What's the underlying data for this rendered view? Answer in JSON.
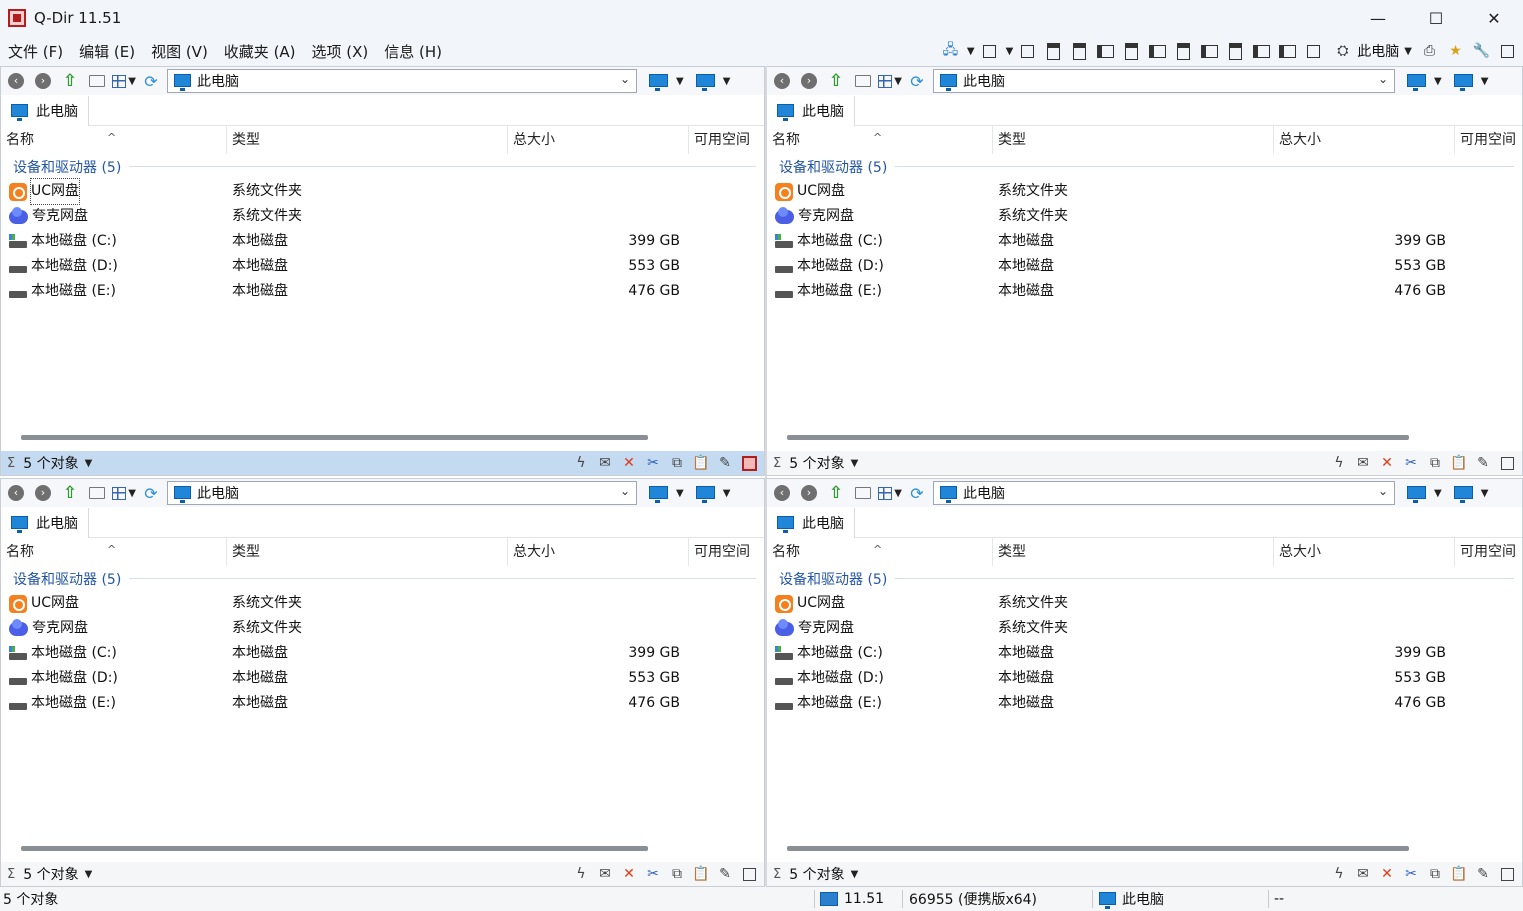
{
  "window": {
    "title": "Q-Dir 11.51",
    "minimize": "—",
    "maximize": "☐",
    "close": "✕"
  },
  "menu": [
    "文件 (F)",
    "编辑 (E)",
    "视图 (V)",
    "收藏夹 (A)",
    "选项 (X)",
    "信息 (H)"
  ],
  "toolbar": {
    "location_label": "此电脑",
    "icons": [
      "network-drive-icon",
      "layout-grid-icon",
      "layout-4-icon",
      "layout-3-icon",
      "layout-2h-icon",
      "layout-2v-icon",
      "layout-a-icon",
      "layout-b-icon",
      "layout-c-icon",
      "layout-d-icon",
      "layout-e-icon",
      "layout-f-icon",
      "layout-g-icon",
      "single-pane-icon",
      "network-icon",
      "printer-icon",
      "favorites-star-icon",
      "zoom-tools-icon",
      "window-icon"
    ]
  },
  "panes": [
    {
      "address": "此电脑",
      "tab": "此电脑",
      "columns": [
        "名称",
        "类型",
        "总大小",
        "可用空间"
      ],
      "group": "设备和驱动器 (5)",
      "rows": [
        {
          "name": "UC网盘",
          "type": "系统文件夹",
          "size": "",
          "icon": "uc-drive-icon"
        },
        {
          "name": "夸克网盘",
          "type": "系统文件夹",
          "size": "",
          "icon": "quark-drive-icon"
        },
        {
          "name": "本地磁盘 (C:)",
          "type": "本地磁盘",
          "size": "399 GB",
          "icon": "system-drive-icon"
        },
        {
          "name": "本地磁盘 (D:)",
          "type": "本地磁盘",
          "size": "553 GB",
          "icon": "drive-icon"
        },
        {
          "name": "本地磁盘 (E:)",
          "type": "本地磁盘",
          "size": "476 GB",
          "icon": "drive-icon"
        }
      ],
      "status": "5 个对象"
    },
    {
      "address": "此电脑",
      "tab": "此电脑",
      "columns": [
        "名称",
        "类型",
        "总大小",
        "可用空间"
      ],
      "group": "设备和驱动器 (5)",
      "rows": [
        {
          "name": "UC网盘",
          "type": "系统文件夹",
          "size": "",
          "icon": "uc-drive-icon"
        },
        {
          "name": "夸克网盘",
          "type": "系统文件夹",
          "size": "",
          "icon": "quark-drive-icon"
        },
        {
          "name": "本地磁盘 (C:)",
          "type": "本地磁盘",
          "size": "399 GB",
          "icon": "system-drive-icon"
        },
        {
          "name": "本地磁盘 (D:)",
          "type": "本地磁盘",
          "size": "553 GB",
          "icon": "drive-icon"
        },
        {
          "name": "本地磁盘 (E:)",
          "type": "本地磁盘",
          "size": "476 GB",
          "icon": "drive-icon"
        }
      ],
      "status": "5 个对象"
    },
    {
      "address": "此电脑",
      "tab": "此电脑",
      "columns": [
        "名称",
        "类型",
        "总大小",
        "可用空间"
      ],
      "group": "设备和驱动器 (5)",
      "rows": [
        {
          "name": "UC网盘",
          "type": "系统文件夹",
          "size": "",
          "icon": "uc-drive-icon"
        },
        {
          "name": "夸克网盘",
          "type": "系统文件夹",
          "size": "",
          "icon": "quark-drive-icon"
        },
        {
          "name": "本地磁盘 (C:)",
          "type": "本地磁盘",
          "size": "399 GB",
          "icon": "system-drive-icon"
        },
        {
          "name": "本地磁盘 (D:)",
          "type": "本地磁盘",
          "size": "553 GB",
          "icon": "drive-icon"
        },
        {
          "name": "本地磁盘 (E:)",
          "type": "本地磁盘",
          "size": "476 GB",
          "icon": "drive-icon"
        }
      ],
      "status": "5 个对象"
    },
    {
      "address": "此电脑",
      "tab": "此电脑",
      "columns": [
        "名称",
        "类型",
        "总大小",
        "可用空间"
      ],
      "group": "设备和驱动器 (5)",
      "rows": [
        {
          "name": "UC网盘",
          "type": "系统文件夹",
          "size": "",
          "icon": "uc-drive-icon"
        },
        {
          "name": "夸克网盘",
          "type": "系统文件夹",
          "size": "",
          "icon": "quark-drive-icon"
        },
        {
          "name": "本地磁盘 (C:)",
          "type": "本地磁盘",
          "size": "399 GB",
          "icon": "system-drive-icon"
        },
        {
          "name": "本地磁盘 (D:)",
          "type": "本地磁盘",
          "size": "553 GB",
          "icon": "drive-icon"
        },
        {
          "name": "本地磁盘 (E:)",
          "type": "本地磁盘",
          "size": "476 GB",
          "icon": "drive-icon"
        }
      ],
      "status": "5 个对象"
    }
  ],
  "bottom_status": {
    "objects": "5 个对象",
    "version": "11.51",
    "build": "66955 (便携版x64)",
    "location": "此电脑",
    "extra": "--"
  },
  "colors": {
    "accent": "#1f86d8",
    "group_text": "#2456a6",
    "active_status": "#c4daf0",
    "chrome": "#f2f5fa"
  }
}
